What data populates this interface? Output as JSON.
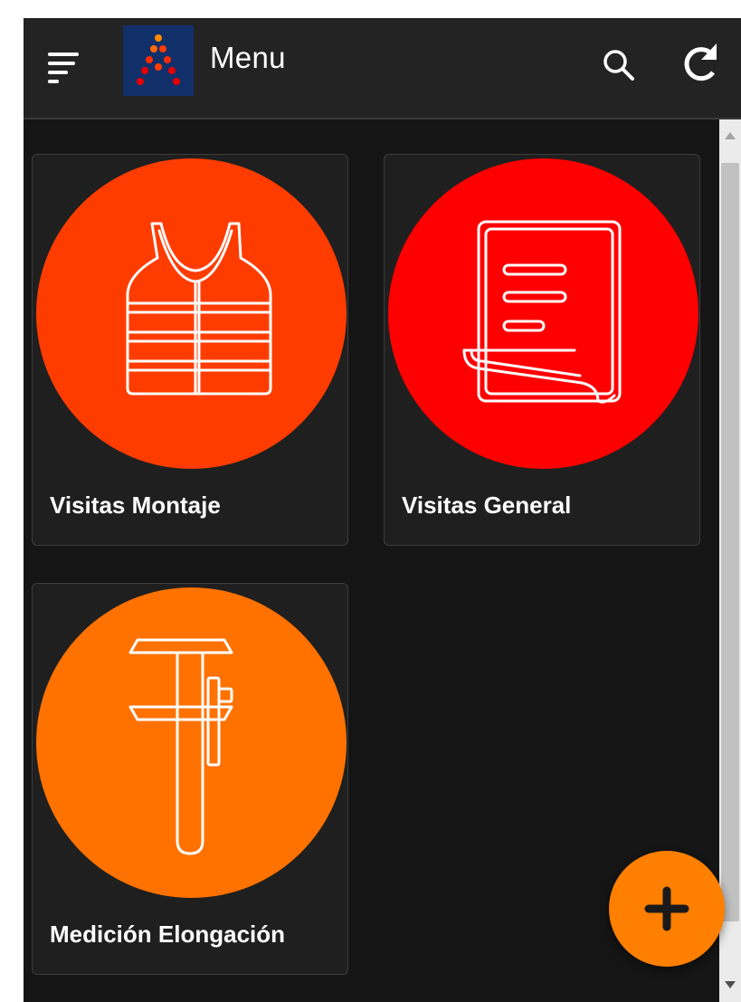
{
  "header": {
    "title": "Menu",
    "menu_icon": "hamburger-menu-icon",
    "logo": "app-logo",
    "search_icon": "search-icon",
    "refresh_icon": "refresh-icon",
    "background": "#232323"
  },
  "tiles": [
    {
      "label": "Visitas Montaje",
      "icon": "life-vest-icon",
      "color": "#ff3c00"
    },
    {
      "label": "Visitas General",
      "icon": "document-scroll-icon",
      "color": "#ff0000"
    },
    {
      "label": "Medición Elongación",
      "icon": "caliper-icon",
      "color": "#ff7200"
    }
  ],
  "fab": {
    "icon": "plus-icon",
    "color": "#ff7f00"
  },
  "colors": {
    "background": "#151515",
    "tile_background": "#1f1f1f"
  }
}
